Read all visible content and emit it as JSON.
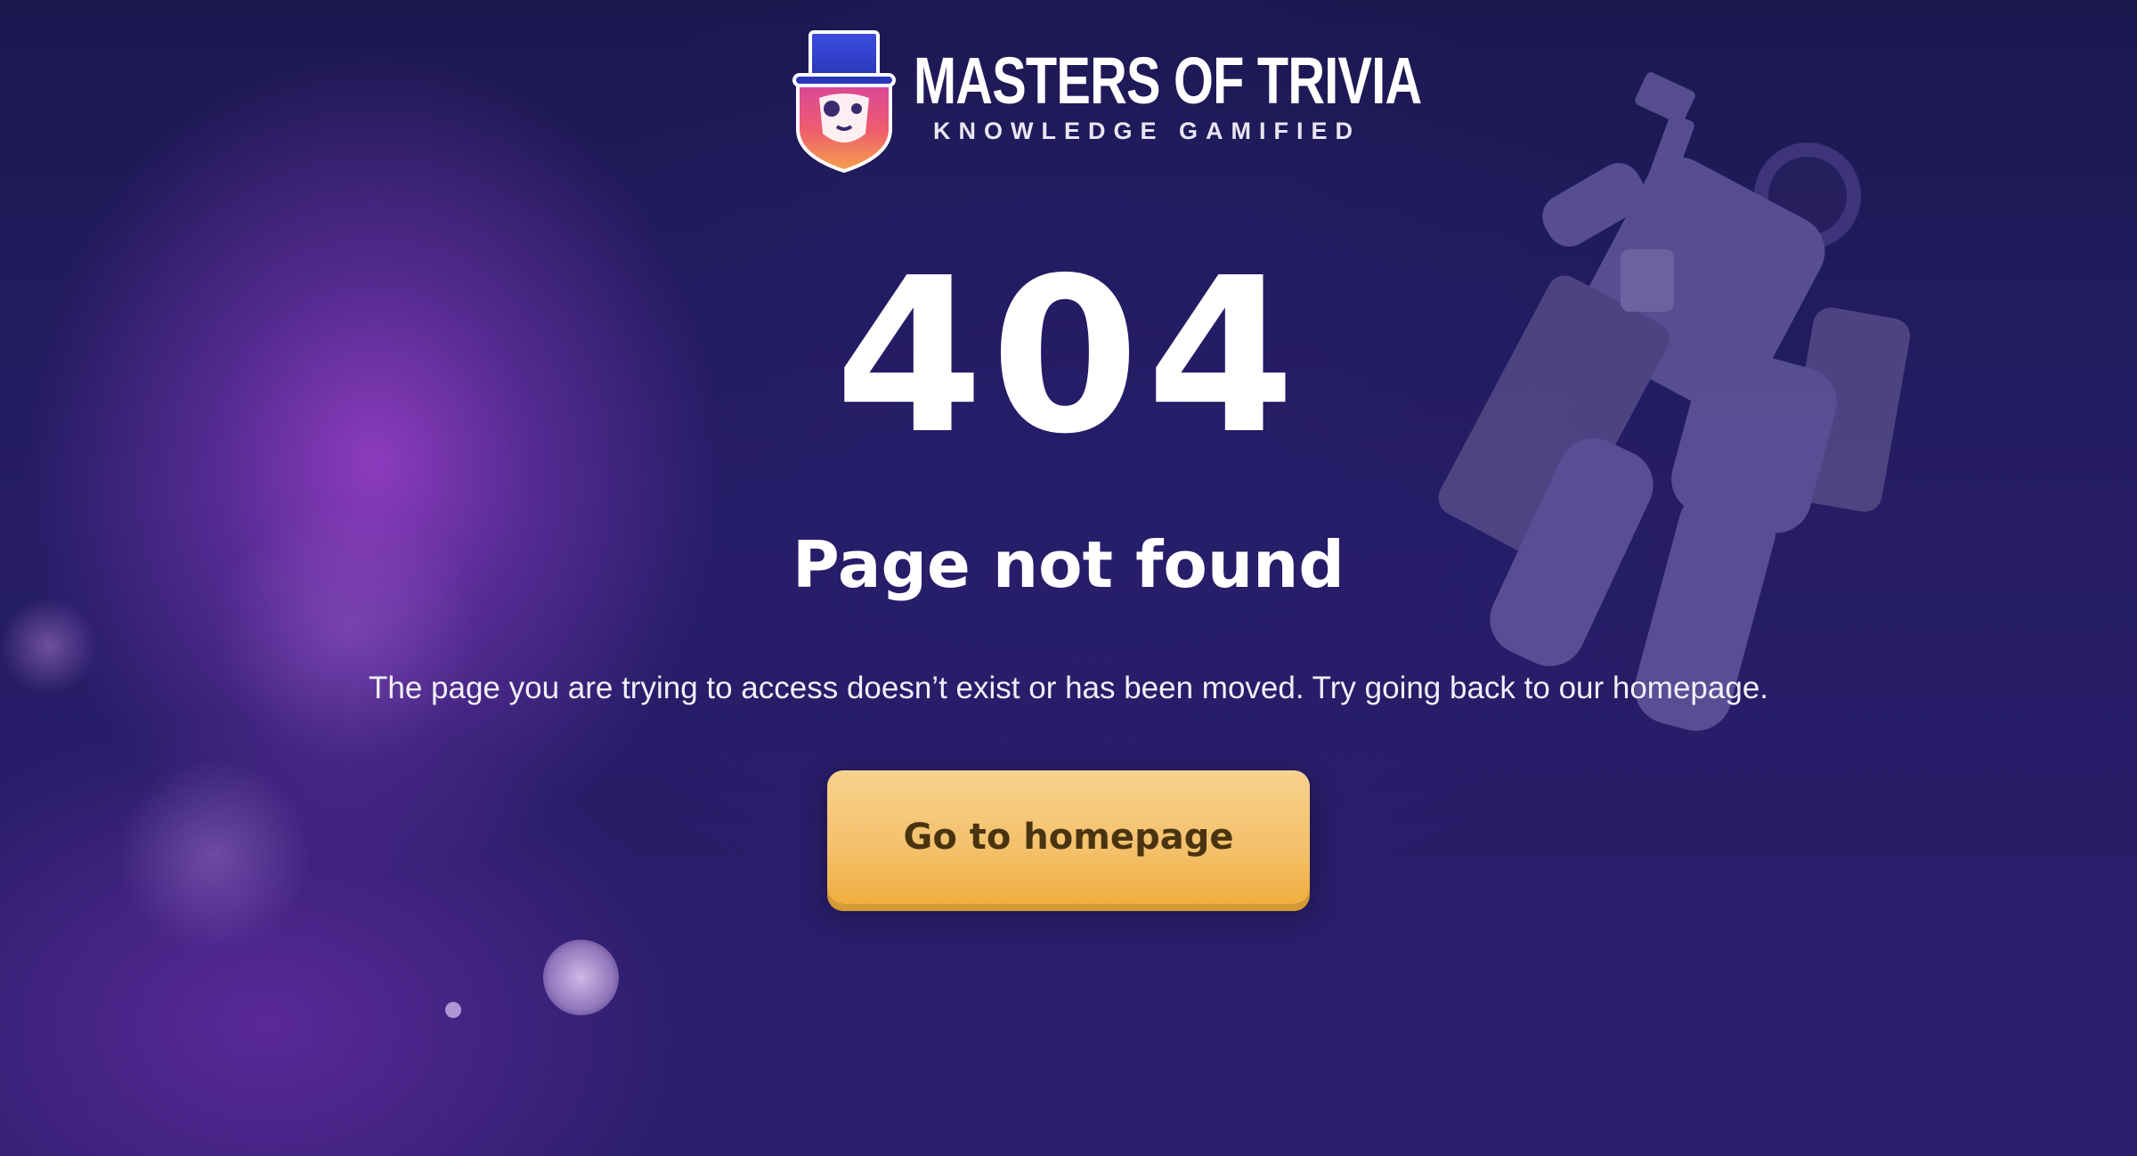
{
  "brand": {
    "name": "MASTERS OF TRIVIA",
    "tagline": "KNOWLEDGE GAMIFIED",
    "logo_icon": "lion-top-hat-shield-icon"
  },
  "error": {
    "code": "404",
    "title": "Page not found",
    "description": "The page you are trying to access doesn’t exist or has been moved. Try going back to our homepage."
  },
  "cta": {
    "label": "Go to homepage"
  },
  "decor": {
    "illustration": "astronaut-illustration"
  },
  "colors": {
    "background": "#221a55",
    "accent_glow": "#b046dc",
    "button": "#f4c06a",
    "button_text": "#4a3410",
    "text": "#ffffff"
  }
}
